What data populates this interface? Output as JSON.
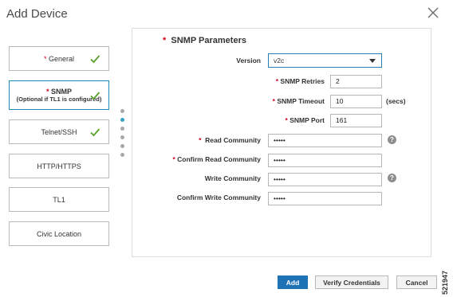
{
  "dialog": {
    "title": "Add Device"
  },
  "steps": [
    {
      "label": "General",
      "required": true,
      "completed": true
    },
    {
      "label": "SNMP",
      "sublabel": "(Optional if TL1 is configured)",
      "required": true,
      "completed": true,
      "active": true
    },
    {
      "label": "Telnet/SSH",
      "required": false,
      "completed": true
    },
    {
      "label": "HTTP/HTTPS",
      "required": false,
      "completed": false
    },
    {
      "label": "TL1",
      "required": false,
      "completed": false
    },
    {
      "label": "Civic Location",
      "required": false,
      "completed": false
    }
  ],
  "snmp": {
    "section_title": "SNMP Parameters",
    "version_label": "Version",
    "version_value": "v2c",
    "retries_label": "SNMP Retries",
    "retries_value": "2",
    "timeout_label": "SNMP Timeout",
    "timeout_value": "10",
    "timeout_unit": "(secs)",
    "port_label": "SNMP Port",
    "port_value": "161",
    "read_community_label": "Read Community",
    "read_community_value": "•••••",
    "confirm_read_label": "Confirm Read Community",
    "confirm_read_value": "•••••",
    "write_community_label": "Write Community",
    "write_community_value": "•••••",
    "confirm_write_label": "Confirm Write Community",
    "confirm_write_value": "•••••"
  },
  "buttons": {
    "add": "Add",
    "verify": "Verify Credentials",
    "cancel": "Cancel"
  },
  "figure_id": "521947",
  "colors": {
    "accent": "#1e73b7",
    "check": "#5aa02c",
    "required": "#d0021b",
    "active_border": "#1b8ab8"
  },
  "icons": {
    "close": "close-icon",
    "check": "check-icon",
    "help": "help-icon",
    "dropdown": "chevron-down-icon"
  }
}
